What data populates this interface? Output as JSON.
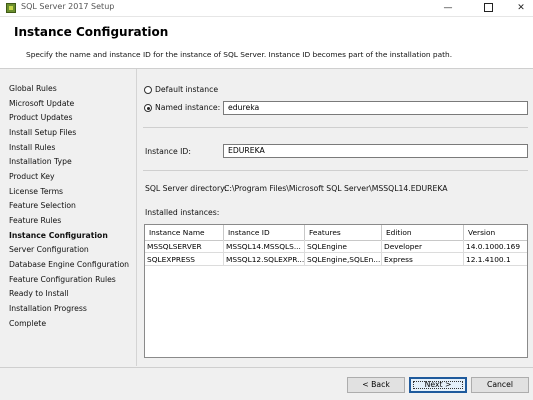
{
  "window": {
    "title": "SQL Server 2017 Setup",
    "controls": {
      "minimize": "—",
      "close": "✕"
    }
  },
  "header": {
    "title": "Instance Configuration",
    "subtitle": "Specify the name and instance ID for the instance of SQL Server. Instance ID becomes part of the installation path."
  },
  "sidebar": {
    "steps": [
      "Global Rules",
      "Microsoft Update",
      "Product Updates",
      "Install Setup Files",
      "Install Rules",
      "Installation Type",
      "Product Key",
      "License Terms",
      "Feature Selection",
      "Feature Rules",
      "Instance Configuration",
      "Server Configuration",
      "Database Engine Configuration",
      "Feature Configuration Rules",
      "Ready to Install",
      "Installation Progress",
      "Complete"
    ],
    "active_step": "Instance Configuration"
  },
  "form": {
    "default_instance_label": "Default instance",
    "named_instance_label": "Named instance:",
    "named_instance_value": "edureka",
    "selected_option": "named_instance",
    "instance_id_label": "Instance ID:",
    "instance_id_value": "EDUREKA",
    "sql_server_directory_label": "SQL Server directory:",
    "sql_server_directory_value": "C:\\Program Files\\Microsoft SQL Server\\MSSQL14.EDUREKA",
    "installed_instances_label": "Installed instances:"
  },
  "installed_instances": {
    "columns": [
      "Instance Name",
      "Instance ID",
      "Features",
      "Edition",
      "Version"
    ],
    "rows": [
      [
        "MSSQLSERVER",
        "MSSQL14.MSSQLS...",
        "SQLEngine",
        "Developer",
        "14.0.1000.169"
      ],
      [
        "SQLEXPRESS",
        "MSSQL12.SQLEXPR...",
        "SQLEngine,SQLEn...",
        "Express",
        "12.1.4100.1"
      ]
    ]
  },
  "buttons": {
    "back": "< Back",
    "next": "Next >",
    "cancel": "Cancel"
  },
  "colors": {
    "accent_border": "#1f5a9c",
    "background": "#f0f0f0"
  }
}
